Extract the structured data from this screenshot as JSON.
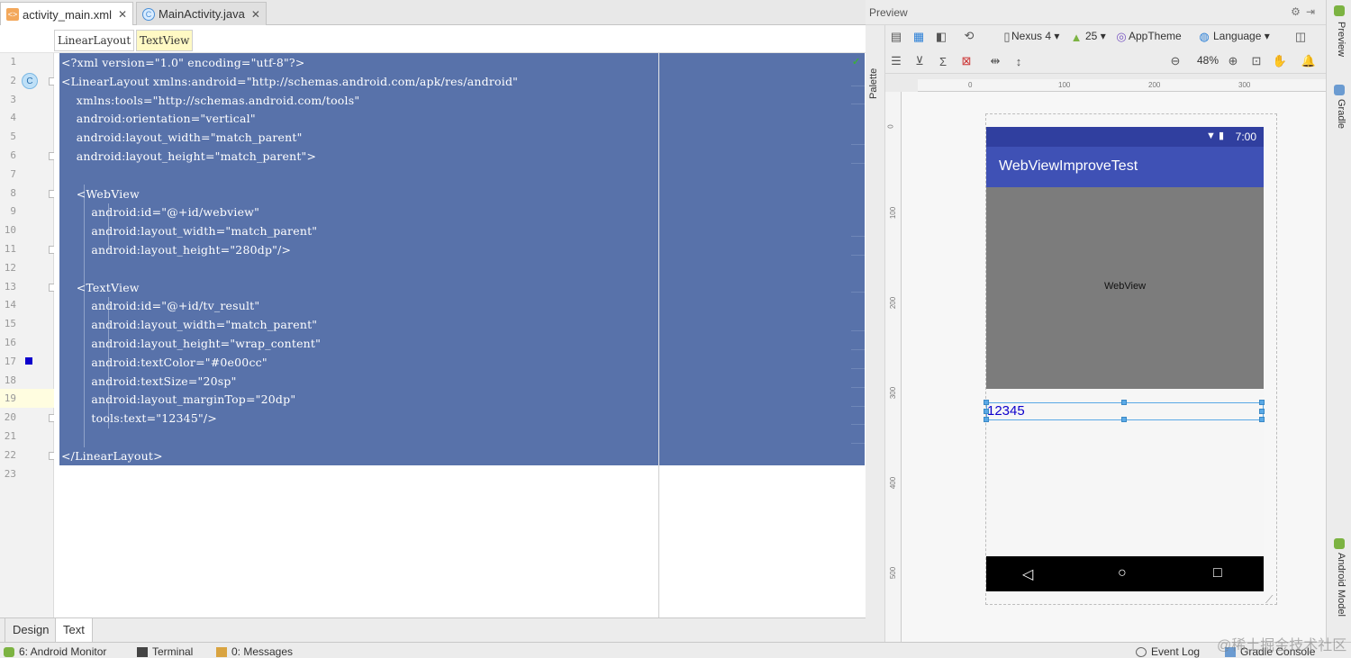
{
  "editor": {
    "tabs": [
      {
        "label": "activity_main.xml",
        "icon": "xml-file-icon",
        "active": true
      },
      {
        "label": "MainActivity.java",
        "icon": "java-class-icon",
        "active": false
      }
    ],
    "breadcrumbs": [
      "LinearLayout",
      "TextView"
    ],
    "line_numbers": [
      "1",
      "2",
      "3",
      "4",
      "5",
      "6",
      "7",
      "8",
      "9",
      "10",
      "11",
      "12",
      "13",
      "14",
      "15",
      "16",
      "17",
      "18",
      "19",
      "20",
      "21",
      "22",
      "23"
    ],
    "code_lines": [
      "<?xml version=\"1.0\" encoding=\"utf-8\"?>",
      "<LinearLayout xmlns:android=\"http://schemas.android.com/apk/res/android\"",
      "    xmlns:tools=\"http://schemas.android.com/tools\"",
      "    android:orientation=\"vertical\"",
      "    android:layout_width=\"match_parent\"",
      "    android:layout_height=\"match_parent\">",
      "",
      "    <WebView",
      "        android:id=\"@+id/webview\"",
      "        android:layout_width=\"match_parent\"",
      "        android:layout_height=\"280dp\"/>",
      "",
      "    <TextView",
      "        android:id=\"@+id/tv_result\"",
      "        android:layout_width=\"match_parent\"",
      "        android:layout_height=\"wrap_content\"",
      "        android:textColor=\"#0e00cc\"",
      "        android:textSize=\"20sp\"",
      "        android:layout_marginTop=\"20dp\"",
      "        tools:text=\"12345\"/>",
      "",
      "</LinearLayout>",
      ""
    ],
    "bottom_tabs": [
      "Design",
      "Text"
    ],
    "selection_color": "#5872aa",
    "text_color_swatch": "#0e00cc"
  },
  "preview": {
    "title": "Preview",
    "palette_label": "Palette",
    "toolbar": {
      "device": "Nexus 4",
      "api": "25",
      "theme": "AppTheme",
      "language": "Language",
      "zoom": "48%"
    },
    "ruler_top": [
      "0",
      "100",
      "200",
      "300"
    ],
    "ruler_left": [
      "0",
      "100",
      "200",
      "300",
      "400",
      "500"
    ],
    "phone": {
      "status_time": "7:00",
      "app_title": "WebViewImproveTest",
      "webview_label": "WebView",
      "textview_text": "12345",
      "statusbar_color": "#303f9f",
      "appbar_color": "#3f51b5"
    }
  },
  "side_strip": {
    "top_labels": [
      "Preview",
      "Gradle"
    ],
    "bottom_label": "Android Model"
  },
  "toolwindows": {
    "left": [
      "6: Android Monitor",
      "Terminal",
      "0: Messages"
    ],
    "right": [
      "Event Log",
      "Gradle Console"
    ]
  },
  "watermark": "@稀土掘金技术社区"
}
